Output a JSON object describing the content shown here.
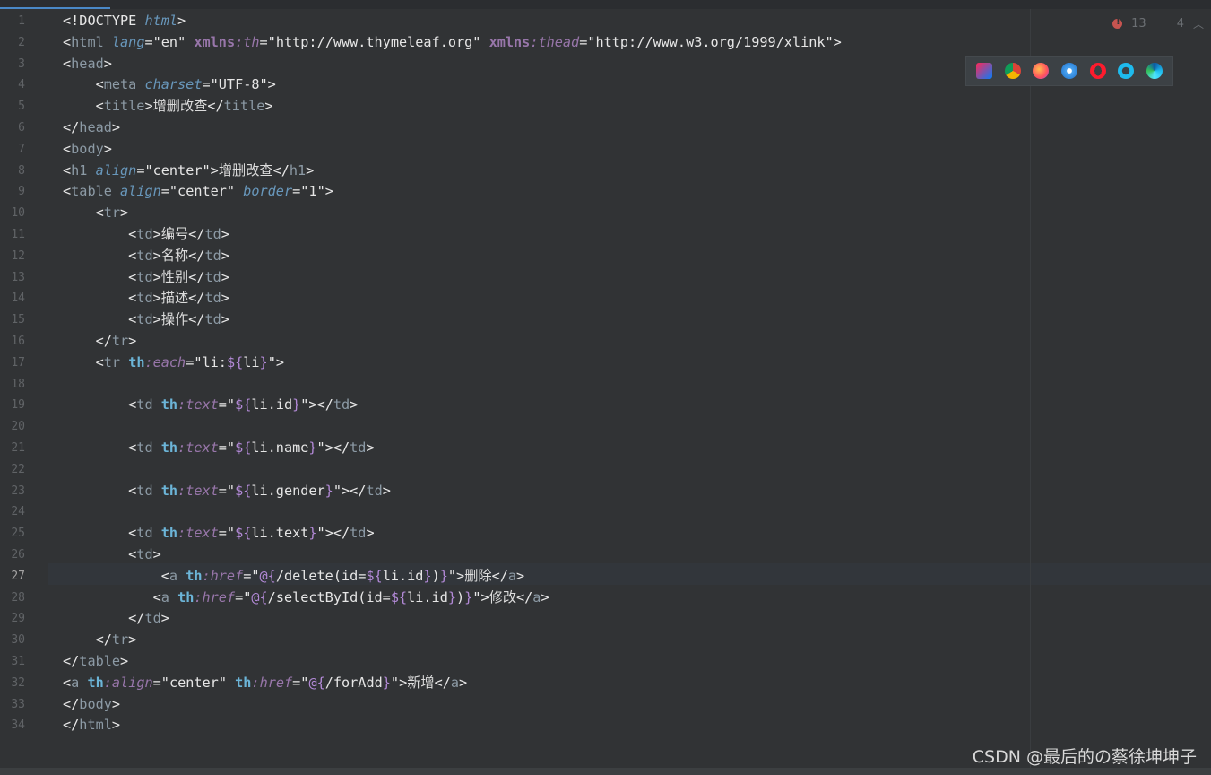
{
  "editor": {
    "inspection_errors": "13",
    "inspection_warnings": "4",
    "current_line": 27,
    "lines": [
      "<!DOCTYPE html>",
      "<html lang=\"en\" xmlns:th=\"http://www.thymeleaf.org\" xmlns:thead=\"http://www.w3.org/1999/xlink\">",
      "<head>",
      "    <meta charset=\"UTF-8\">",
      "    <title>增删改查</title>",
      "</head>",
      "<body>",
      "<h1 align=\"center\">增删改查</h1>",
      "<table align=\"center\" border=\"1\">",
      "    <tr>",
      "        <td>编号</td>",
      "        <td>名称</td>",
      "        <td>性别</td>",
      "        <td>描述</td>",
      "        <td>操作</td>",
      "    </tr>",
      "    <tr th:each=\"li:${li}\">",
      "",
      "        <td th:text=\"${li.id}\"></td>",
      "",
      "        <td th:text=\"${li.name}\"></td>",
      "",
      "        <td th:text=\"${li.gender}\"></td>",
      "",
      "        <td th:text=\"${li.text}\"></td>",
      "        <td>",
      "            <a th:href=\"@{/delete(id=${li.id})}\">删除</a>",
      "           <a th:href=\"@{/selectById(id=${li.id})}\">修改</a>",
      "        </td>",
      "    </tr>",
      "</table>",
      "<a th:align=\"center\" th:href=\"@{/forAdd}\">新增</a>",
      "</body>",
      "</html>"
    ]
  },
  "browser_icons": [
    "intellij-icon",
    "chrome-icon",
    "firefox-icon",
    "safari-icon",
    "opera-icon",
    "ie-icon",
    "edge-icon"
  ],
  "colors": {
    "background": "#2b2d30",
    "editor_bg": "#313335",
    "tag": "#e8bf6a",
    "string": "#6a8759",
    "attribute": "#9876aa",
    "line_number": "#606366",
    "error": "#c75450"
  },
  "watermark": "CSDN @最后的の蔡徐坤坤子"
}
